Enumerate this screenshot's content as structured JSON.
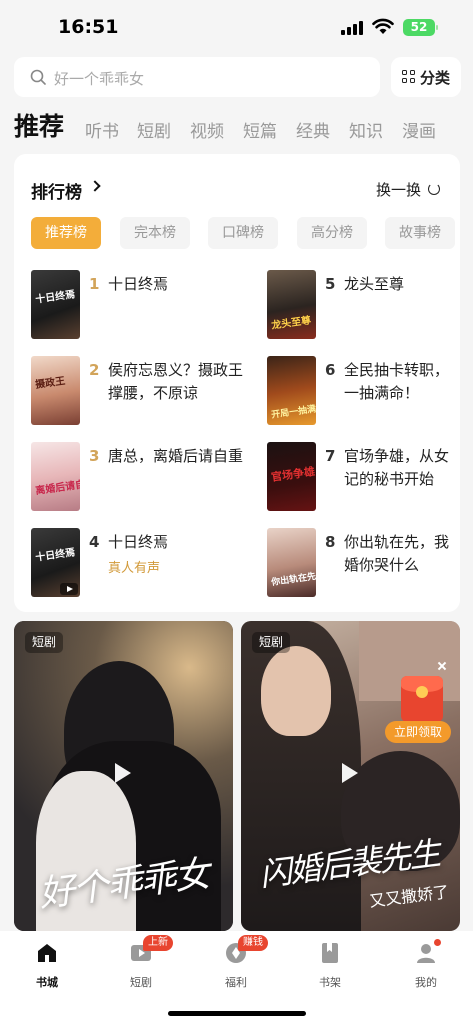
{
  "status_bar": {
    "time": "16:51",
    "battery": "52"
  },
  "search": {
    "placeholder": "好一个乖乖女",
    "category_label": "分类"
  },
  "tabs": [
    "推荐",
    "听书",
    "短剧",
    "视频",
    "短篇",
    "经典",
    "知识",
    "漫画"
  ],
  "ranking": {
    "title": "排行榜",
    "refresh_label": "换一换",
    "chips": [
      "推荐榜",
      "完本榜",
      "口碑榜",
      "高分榜",
      "故事榜"
    ],
    "items": [
      {
        "rank": "1",
        "name": "十日终焉",
        "sub": "",
        "cover_text": "十日终焉"
      },
      {
        "rank": "2",
        "name": "侯府忘恩义？摄政王撑腰，不原谅",
        "sub": "",
        "cover_text": "摄政王"
      },
      {
        "rank": "3",
        "name": "唐总，离婚后请自重",
        "sub": "",
        "cover_text": "离婚后请自重"
      },
      {
        "rank": "4",
        "name": "十日终焉",
        "sub": "真人有声",
        "cover_text": "十日终焉"
      },
      {
        "rank": "5",
        "name": "龙头至尊",
        "sub": "",
        "cover_text": "龙头至尊"
      },
      {
        "rank": "6",
        "name": "全民抽卡转职，一抽满命！",
        "sub": "",
        "cover_text": "开局一抽满命"
      },
      {
        "rank": "7",
        "name": "官场争雄，从女记的秘书开始",
        "sub": "",
        "cover_text": "官场争雄"
      },
      {
        "rank": "8",
        "name": "你出轨在先，我婚你哭什么",
        "sub": "",
        "cover_text": "你出轨在先"
      }
    ]
  },
  "videos": [
    {
      "tag": "短剧",
      "title_art": "好个乖乖女",
      "subtitle_art": ""
    },
    {
      "tag": "短剧",
      "title_art": "闪婚后裴先生",
      "subtitle_art": "又又撒娇了"
    }
  ],
  "promo": {
    "claim_label": "立即领取"
  },
  "bottom_nav": [
    {
      "label": "书城",
      "icon": "home-icon",
      "badge": ""
    },
    {
      "label": "短剧",
      "icon": "video-play-icon",
      "badge": "上新"
    },
    {
      "label": "福利",
      "icon": "coin-icon",
      "badge": "赚钱"
    },
    {
      "label": "书架",
      "icon": "bookmark-book-icon",
      "badge": ""
    },
    {
      "label": "我的",
      "icon": "user-icon",
      "badge": ""
    }
  ],
  "colors": {
    "accent": "#f3ad3a",
    "rank_top": "#d2a45a",
    "badge_red": "#e8452f"
  }
}
